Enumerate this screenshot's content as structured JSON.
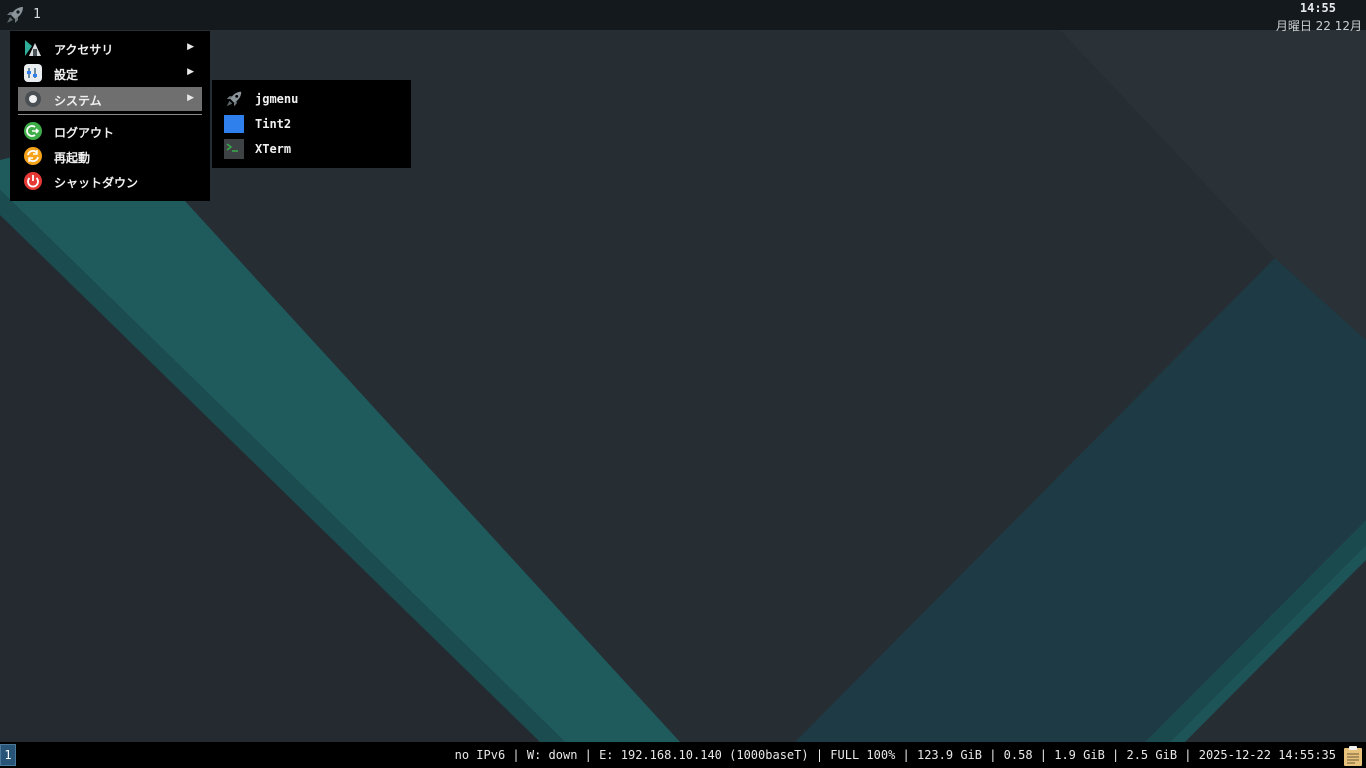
{
  "top_panel": {
    "launcher_icon": "rocket-icon",
    "workspace": "1",
    "clock": {
      "time": "14:55",
      "date": "月曜日 22 12月"
    }
  },
  "menu": {
    "items": [
      {
        "label": "アクセサリ",
        "icon": "accessories-icon",
        "submenu": true,
        "arrow": "▶"
      },
      {
        "label": "設定",
        "icon": "settings-icon",
        "submenu": true,
        "arrow": "▶"
      },
      {
        "label": "システム",
        "icon": "system-icon",
        "submenu": true,
        "arrow": "▶",
        "active": true
      },
      {
        "label": "ログアウト",
        "icon": "logout-icon",
        "color": "#3fae49"
      },
      {
        "label": "再起動",
        "icon": "reboot-icon",
        "color": "#f5a31a"
      },
      {
        "label": "シャットダウン",
        "icon": "shutdown-icon",
        "color": "#e53935"
      }
    ]
  },
  "submenu": {
    "items": [
      {
        "label": "jgmenu",
        "icon": "rocket-icon"
      },
      {
        "label": "Tint2",
        "icon": "tint2-icon",
        "color": "#2f80ed"
      },
      {
        "label": "XTerm",
        "icon": "terminal-icon"
      }
    ]
  },
  "bottom_bar": {
    "workspace": "1",
    "status": "no IPv6 | W: down | E: 192.168.10.140 (1000baseT) | FULL 100% | 123.9 GiB | 0.58 | 1.9 GiB | 2.5 GiB | 2025-12-22 14:55:35",
    "tray_icon": "clipboard-icon"
  },
  "colors": {
    "wallpaper_dark": "#262d33",
    "wallpaper_teal": "#1f5a5c",
    "wallpaper_teal_right": "#1e3a44",
    "menu_active": "#6f6f6f",
    "workspace_tag": "#285577"
  }
}
